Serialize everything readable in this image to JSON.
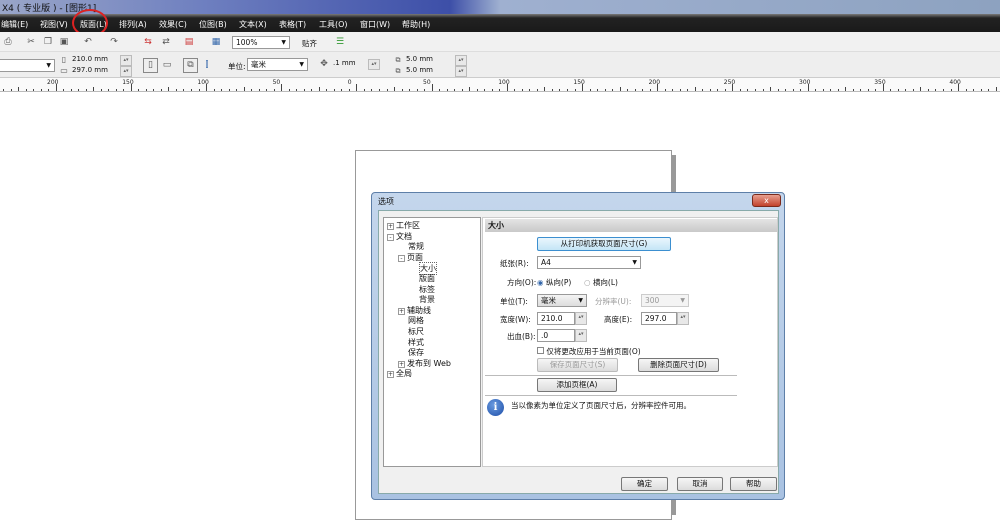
{
  "window": {
    "title": "X4 ( 专业版 ) - [图形1]"
  },
  "menu": [
    "编辑(E)",
    "视图(V)",
    "版面(L)",
    "排列(A)",
    "效果(C)",
    "位图(B)",
    "文本(X)",
    "表格(T)",
    "工具(O)",
    "窗口(W)",
    "帮助(H)"
  ],
  "toolbar": {
    "zoom": "100%",
    "snap": "贴齐"
  },
  "propbar": {
    "width": "210.0 mm",
    "height": "297.0 mm",
    "unit_label": "单位:",
    "unit": "毫米",
    "nudge": ".1 mm",
    "dup_x": "5.0 mm",
    "dup_y": "5.0 mm"
  },
  "ruler": [
    "200",
    "150",
    "100",
    "50",
    "0",
    "50",
    "100",
    "150",
    "200",
    "250",
    "300",
    "350",
    "400"
  ],
  "dialog": {
    "title": "选项",
    "close": "x",
    "tree": [
      {
        "label": "工作区",
        "exp": "+"
      },
      {
        "label": "文档",
        "exp": "-"
      },
      {
        "label": "常规"
      },
      {
        "label": "页面",
        "exp": "-"
      },
      {
        "label": "大小"
      },
      {
        "label": "版面"
      },
      {
        "label": "标签"
      },
      {
        "label": "背景"
      },
      {
        "label": "辅助线",
        "exp": "+"
      },
      {
        "label": "网格"
      },
      {
        "label": "标尺"
      },
      {
        "label": "样式"
      },
      {
        "label": "保存"
      },
      {
        "label": "发布到 Web",
        "exp": "+"
      },
      {
        "label": "全局",
        "exp": "+"
      }
    ],
    "header": "大小",
    "get_from_printer": "从打印机获取页面尺寸(G)",
    "paper_label": "纸张(R):",
    "paper": "A4",
    "orient_label": "方向(O):",
    "portrait": "纵向(P)",
    "landscape": "横向(L)",
    "unit_label": "单位(T):",
    "unit": "毫米",
    "res_label": "分辨率(U):",
    "res": "300",
    "width_label": "宽度(W):",
    "width": "210.0",
    "height_label": "高度(E):",
    "height": "297.0",
    "bleed_label": "出血(B):",
    "bleed": ".0",
    "apply_current": "仅将更改应用于当前页面(O)",
    "save_size": "保存页面尺寸(S)",
    "delete_size": "删除页面尺寸(D)",
    "add_frame": "添加页框(A)",
    "info": "当以像素为单位定义了页面尺寸后，分辨率控件可用。",
    "ok": "确定",
    "cancel": "取消",
    "help": "帮助"
  }
}
